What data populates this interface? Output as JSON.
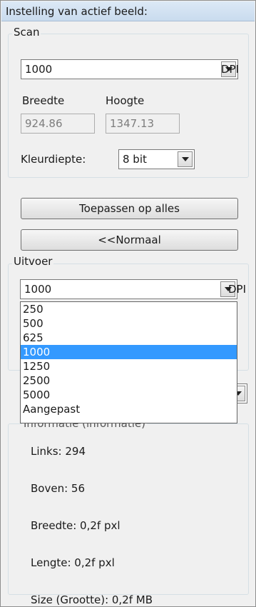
{
  "header": {
    "title": "Instelling van actief beeld:"
  },
  "scan": {
    "group_label": "Scan",
    "dpi_value": "1000",
    "dpi_unit": "DPI",
    "width_label": "Breedte",
    "height_label": "Hoogte",
    "width_value": "924.86",
    "height_value": "1347.13",
    "color_depth_label": "Kleurdiepte:",
    "color_depth_value": "8 bit"
  },
  "buttons": {
    "apply_all": "Toepassen op alles",
    "normal": "<<Normaal"
  },
  "output": {
    "group_label": "Uitvoer",
    "dpi_value": "1000",
    "dpi_unit": "DPI",
    "dropdown_options": [
      "250",
      "500",
      "625",
      "1000",
      "1250",
      "2500",
      "5000",
      "Aangepast"
    ],
    "selected_index": 3
  },
  "info": {
    "partial_label": "Informatie (informatie)",
    "left": "Links: 294",
    "top": "Boven: 56",
    "width": "Breedte: 0,2f pxl",
    "length": "Lengte: 0,2f pxl",
    "size": "Size (Grootte): 0,2f MB"
  },
  "colors": {
    "selection": "#3399ff",
    "header_bg": "#c9dbee",
    "panel_bg": "#f0f0f0"
  },
  "icons": {
    "dropdown_arrow": "chevron-down-icon"
  }
}
